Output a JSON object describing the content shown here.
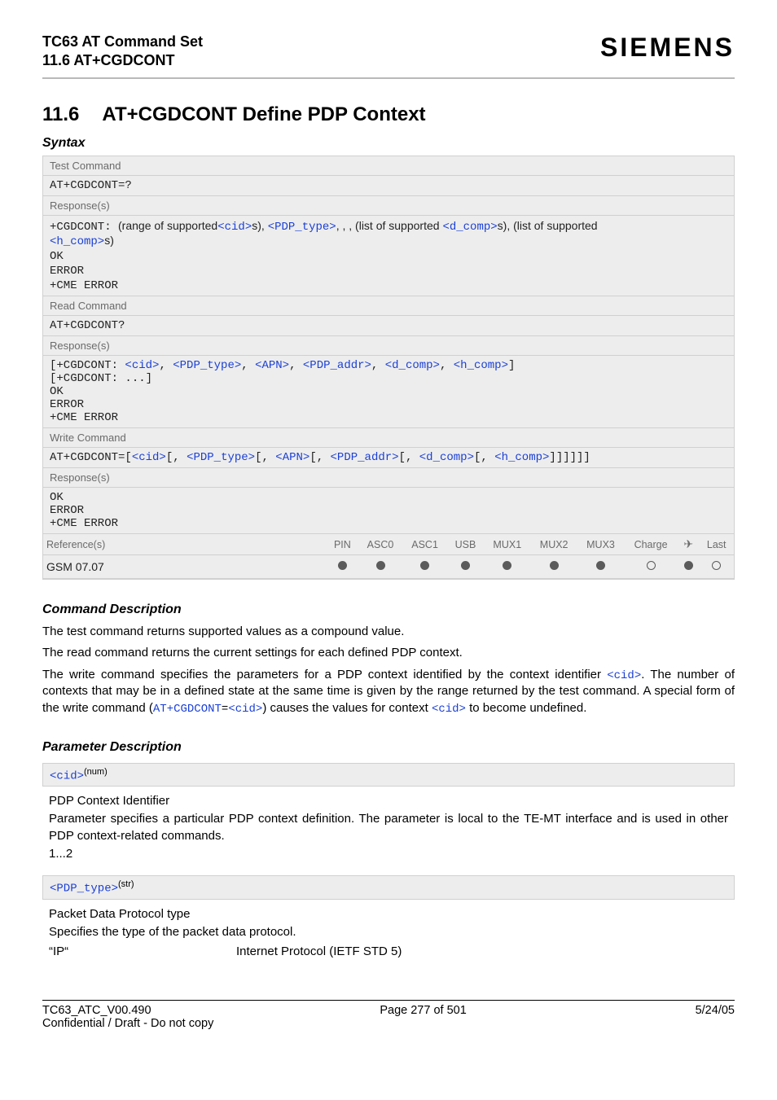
{
  "header": {
    "title1": "TC63 AT Command Set",
    "title2": "11.6 AT+CGDCONT",
    "brand": "SIEMENS"
  },
  "section": {
    "number": "11.6",
    "title": "AT+CGDCONT   Define PDP Context",
    "syntax_label": "Syntax"
  },
  "labels": {
    "test_cmd": "Test Command",
    "read_cmd": "Read Command",
    "write_cmd": "Write Command",
    "responses": "Response(s)",
    "references": "Reference(s)"
  },
  "test": {
    "cmd": "AT+CGDCONT=?",
    "resp_prefix": "+CGDCONT: ",
    "resp_text1a": "(range of supported",
    "resp_cid": "<cid>",
    "resp_text1b": "s), ",
    "resp_pdptype": "<PDP_type>",
    "resp_text1c": ", , , (list of supported ",
    "resp_dcomp": "<d_comp>",
    "resp_text1d": "s), (list of supported ",
    "resp_hcomp": "<h_comp>",
    "resp_text1e": "s)",
    "ok": "OK",
    "error": "ERROR",
    "cme": "+CME ERROR"
  },
  "read": {
    "cmd": "AT+CGDCONT?",
    "open": "[",
    "prefix": "+CGDCONT: ",
    "cid": "<cid>",
    "pdptype": "<PDP_type>",
    "apn": "<APN>",
    "pdpaddr": "<PDP_addr>",
    "dcomp": "<d_comp>",
    "hcomp": "<h_comp>",
    "close": "]",
    "line2": "[+CGDCONT: ...]",
    "ok": "OK",
    "error": "ERROR",
    "cme": "+CME ERROR",
    "comma": ", "
  },
  "write": {
    "cmd_pre": "AT+CGDCONT=",
    "open": "[",
    "cid": "<cid>",
    "pdptype": "<PDP_type>",
    "apn": "<APN>",
    "pdpaddr": "<PDP_addr>",
    "dcomp": "<d_comp>",
    "hcomp": "<h_comp>",
    "close": "]]]]]]",
    "sep": "[, ",
    "ok": "OK",
    "error": "ERROR",
    "cme": "+CME ERROR"
  },
  "ref": {
    "headers": [
      "PIN",
      "ASC0",
      "ASC1",
      "USB",
      "MUX1",
      "MUX2",
      "MUX3",
      "Charge",
      "✈",
      "Last"
    ],
    "value": "GSM 07.07",
    "dots": [
      "f",
      "f",
      "f",
      "f",
      "f",
      "f",
      "f",
      "e",
      "f",
      "e"
    ]
  },
  "cmd_desc": {
    "title": "Command Description",
    "p1": "The test command returns supported values as a compound value.",
    "p2": "The read command returns the current settings for each defined PDP context.",
    "p3a": "The write command specifies the parameters for a PDP context identified by the context identifier ",
    "p3cid": "<cid>",
    "p3b": ". The number of contexts that may be in a defined state at the same time is given by the range returned by the test command. A special form of the write command (",
    "p3link": "AT+CGDCONT",
    "p3eq": "=",
    "p3cid2": "<cid>",
    "p3c": ") causes the values for context ",
    "p3cid3": "<cid>",
    "p3d": " to become undefined."
  },
  "param_desc": {
    "title": "Parameter Description",
    "cid": {
      "name": "<cid>",
      "sup": "(num)",
      "l1": "PDP Context Identifier",
      "l2": "Parameter specifies a particular PDP context definition. The parameter is local to the TE-MT interface and is used in other PDP context-related commands.",
      "range": "1...2"
    },
    "pdptype": {
      "name": "<PDP_type>",
      "sup": "(str)",
      "l1": "Packet Data Protocol type",
      "l2": "Specifies the type of the packet data protocol.",
      "key": "“IP“",
      "val": "Internet Protocol (IETF STD 5)"
    }
  },
  "footer": {
    "left1": "TC63_ATC_V00.490",
    "left2": "Confidential / Draft - Do not copy",
    "center": "Page 277 of 501",
    "right": "5/24/05"
  }
}
